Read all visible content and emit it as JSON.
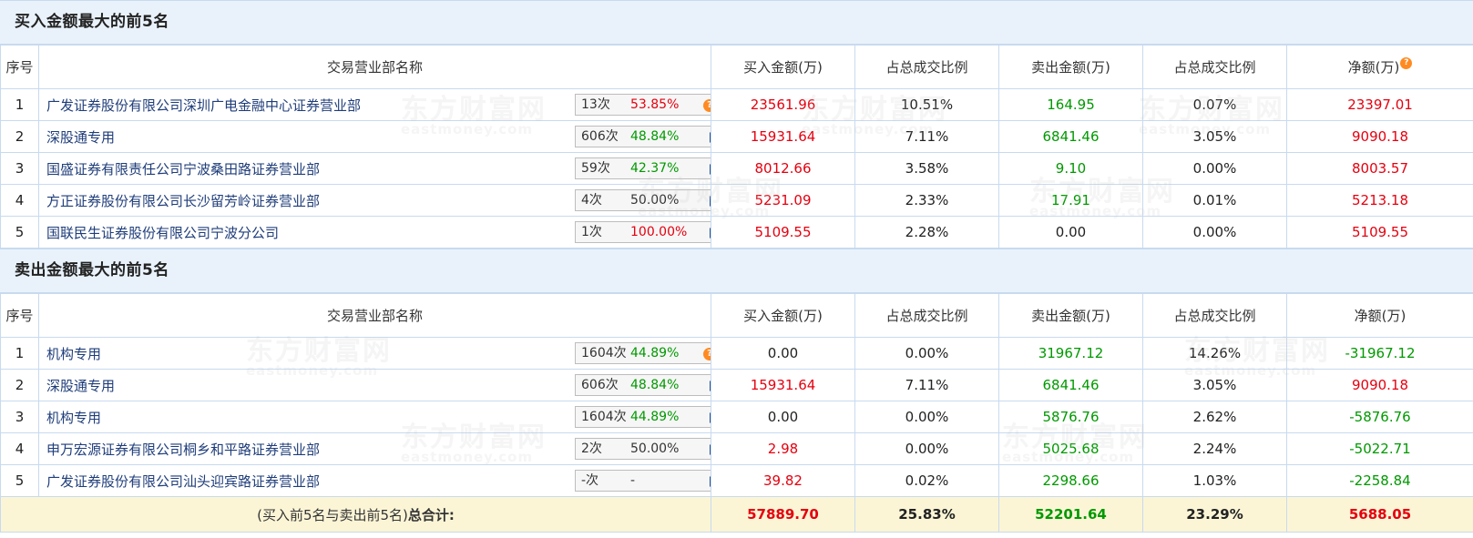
{
  "buy_section": {
    "title": "买入金额最大的前5名",
    "headers": [
      "序号",
      "交易营业部名称",
      "买入金额(万)",
      "占总成交比例",
      "卖出金额(万)",
      "占总成交比例",
      "净额(万)"
    ],
    "rows": [
      {
        "idx": "1",
        "name": "广发证券股份有限公司深圳广电金融中心证券营业部",
        "count": "13次",
        "pct": "53.85%",
        "pct_color": "red",
        "icon": "question-icon",
        "buy": "23561.96",
        "buy_ratio": "10.51%",
        "sell": "164.95",
        "sell_ratio": "0.07%",
        "net": "23397.01",
        "net_color": "red"
      },
      {
        "idx": "2",
        "name": "深股通专用",
        "count": "606次",
        "pct": "48.84%",
        "pct_color": "green",
        "icon": "arrow-right-icon",
        "buy": "15931.64",
        "buy_ratio": "7.11%",
        "sell": "6841.46",
        "sell_ratio": "3.05%",
        "net": "9090.18",
        "net_color": "red"
      },
      {
        "idx": "3",
        "name": "国盛证券有限责任公司宁波桑田路证券营业部",
        "count": "59次",
        "pct": "42.37%",
        "pct_color": "green",
        "icon": "arrow-right-icon",
        "buy": "8012.66",
        "buy_ratio": "3.58%",
        "sell": "9.10",
        "sell_ratio": "0.00%",
        "net": "8003.57",
        "net_color": "red"
      },
      {
        "idx": "4",
        "name": "方正证券股份有限公司长沙留芳岭证券营业部",
        "count": "4次",
        "pct": "50.00%",
        "pct_color": "plain",
        "icon": "arrow-right-icon",
        "buy": "5231.09",
        "buy_ratio": "2.33%",
        "sell": "17.91",
        "sell_ratio": "0.01%",
        "net": "5213.18",
        "net_color": "red"
      },
      {
        "idx": "5",
        "name": "国联民生证券股份有限公司宁波分公司",
        "count": "1次",
        "pct": "100.00%",
        "pct_color": "red",
        "icon": "arrow-right-icon",
        "buy": "5109.55",
        "buy_ratio": "2.28%",
        "sell": "0.00",
        "sell_ratio": "0.00%",
        "net": "5109.55",
        "net_color": "red"
      }
    ]
  },
  "sell_section": {
    "title": "卖出金额最大的前5名",
    "headers": [
      "序号",
      "交易营业部名称",
      "买入金额(万)",
      "占总成交比例",
      "卖出金额(万)",
      "占总成交比例",
      "净额(万)"
    ],
    "rows": [
      {
        "idx": "1",
        "name": "机构专用",
        "count": "1604次",
        "pct": "44.89%",
        "pct_color": "green",
        "icon": "question-icon",
        "buy": "0.00",
        "buy_ratio": "0.00%",
        "sell": "31967.12",
        "sell_ratio": "14.26%",
        "net": "-31967.12",
        "net_color": "green"
      },
      {
        "idx": "2",
        "name": "深股通专用",
        "count": "606次",
        "pct": "48.84%",
        "pct_color": "green",
        "icon": "arrow-right-icon",
        "buy": "15931.64",
        "buy_ratio": "7.11%",
        "sell": "6841.46",
        "sell_ratio": "3.05%",
        "net": "9090.18",
        "net_color": "red"
      },
      {
        "idx": "3",
        "name": "机构专用",
        "count": "1604次",
        "pct": "44.89%",
        "pct_color": "green",
        "icon": "arrow-right-icon",
        "buy": "0.00",
        "buy_ratio": "0.00%",
        "sell": "5876.76",
        "sell_ratio": "2.62%",
        "net": "-5876.76",
        "net_color": "green"
      },
      {
        "idx": "4",
        "name": "申万宏源证券有限公司桐乡和平路证券营业部",
        "count": "2次",
        "pct": "50.00%",
        "pct_color": "plain",
        "icon": "arrow-right-icon",
        "buy": "2.98",
        "buy_ratio": "0.00%",
        "sell": "5025.68",
        "sell_ratio": "2.24%",
        "net": "-5022.71",
        "net_color": "green"
      },
      {
        "idx": "5",
        "name": "广发证券股份有限公司汕头迎宾路证券营业部",
        "count": "-次",
        "pct": "-",
        "pct_color": "plain",
        "icon": "arrow-right-icon",
        "buy": "39.82",
        "buy_ratio": "0.02%",
        "sell": "2298.66",
        "sell_ratio": "1.03%",
        "net": "-2258.84",
        "net_color": "green"
      }
    ]
  },
  "total": {
    "label_prefix": "(买入前5名与卖出前5名)",
    "label_bold": "总合计:",
    "buy": "57889.70",
    "buy_ratio": "25.83%",
    "sell": "52201.64",
    "sell_ratio": "23.29%",
    "net": "5688.05"
  },
  "watermark": {
    "cn": "东方财富网",
    "en": "eastmoney.com"
  },
  "colors": {
    "red": "#e5000f",
    "green": "#009900",
    "header_bg": "#e9f2fb",
    "total_bg": "#fbf5d6",
    "accent": "#ff8a22"
  }
}
